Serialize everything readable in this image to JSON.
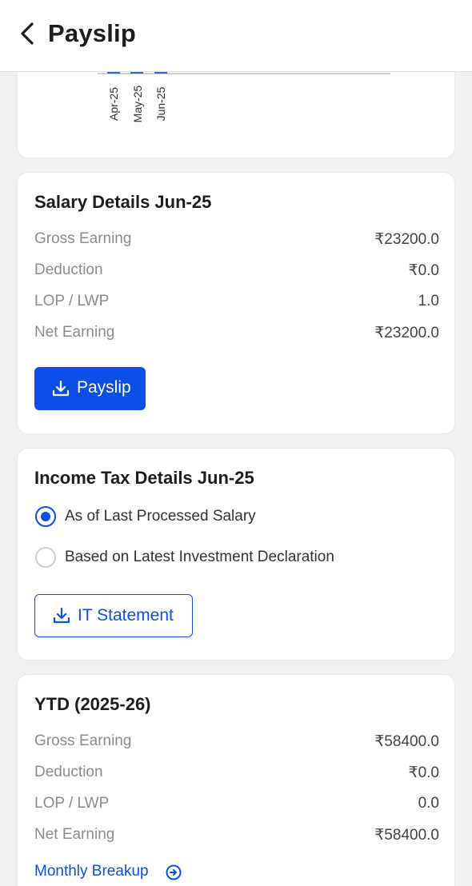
{
  "header": {
    "title": "Payslip",
    "back_icon": "chevron-left-icon"
  },
  "chart": {
    "tick_labels": [
      "Apr-25",
      "May-25",
      "Jun-25"
    ]
  },
  "salary": {
    "title": "Salary Details Jun-25",
    "rows": [
      {
        "label": "Gross Earning",
        "value": "₹23200.0"
      },
      {
        "label": "Deduction",
        "value": "₹0.0"
      },
      {
        "label": "LOP / LWP",
        "value": "1.0"
      },
      {
        "label": "Net Earning",
        "value": "₹23200.0"
      }
    ],
    "button_label": "Payslip",
    "button_icon": "download-icon"
  },
  "tax": {
    "title": "Income Tax Details Jun-25",
    "options": [
      {
        "label": "As of Last Processed Salary",
        "selected": true
      },
      {
        "label": "Based on Latest Investment Declaration",
        "selected": false
      }
    ],
    "button_label": "IT Statement",
    "button_icon": "download-icon"
  },
  "ytd": {
    "title": "YTD (2025-26)",
    "rows": [
      {
        "label": "Gross Earning",
        "value": "₹58400.0"
      },
      {
        "label": "Deduction",
        "value": "₹0.0"
      },
      {
        "label": "LOP / LWP",
        "value": "0.0"
      },
      {
        "label": "Net Earning",
        "value": "₹58400.0"
      }
    ],
    "link_label": "Monthly Breakup",
    "link_icon": "arrow-circle-right-icon"
  },
  "colors": {
    "accent": "#0b4fe6",
    "bar": "#2e66e0"
  }
}
